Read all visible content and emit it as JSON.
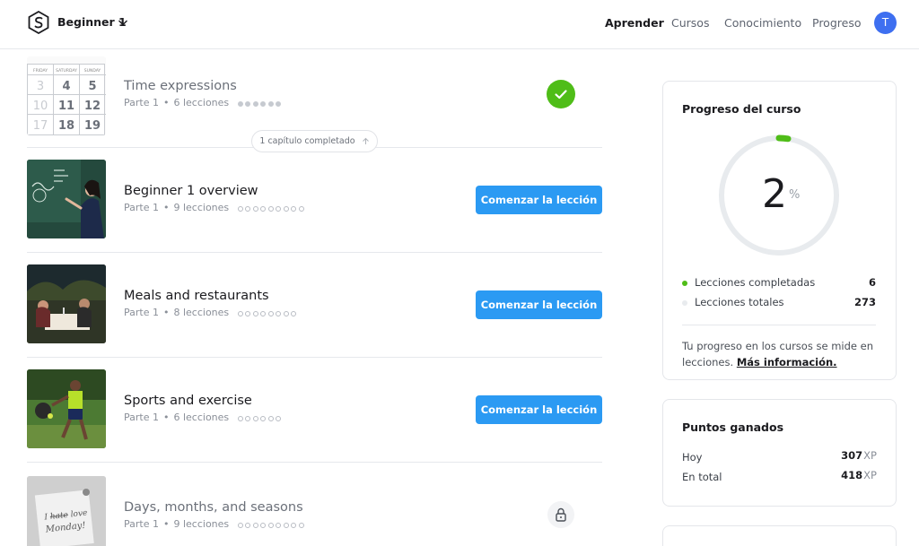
{
  "header": {
    "course_name": "Beginner 1",
    "nav": [
      "Aprender",
      "Cursos",
      "Conocimiento",
      "Progreso"
    ],
    "active_nav": "Aprender",
    "avatar_initial": "T"
  },
  "lessons": [
    {
      "title": "Time expressions",
      "part": "Parte 1",
      "count": "6 lecciones",
      "dots_total": 6,
      "dots_filled": 6,
      "state": "completed"
    },
    {
      "title": "Beginner 1 overview",
      "part": "Parte 1",
      "count": "9 lecciones",
      "dots_total": 9,
      "dots_filled": 0,
      "state": "start",
      "button": "Comenzar la lección"
    },
    {
      "title": "Meals and restaurants",
      "part": "Parte 1",
      "count": "8 lecciones",
      "dots_total": 8,
      "dots_filled": 0,
      "state": "start",
      "button": "Comenzar la lección"
    },
    {
      "title": "Sports and exercise",
      "part": "Parte 1",
      "count": "6 lecciones",
      "dots_total": 6,
      "dots_filled": 0,
      "state": "start",
      "button": "Comenzar la lección"
    },
    {
      "title": "Days, months, and seasons",
      "part": "Parte 1",
      "count": "9 lecciones",
      "dots_total": 9,
      "dots_filled": 0,
      "state": "locked"
    }
  ],
  "chapter_pill": "1 capítulo completado",
  "calendar": {
    "days": [
      "FRIDAY",
      "SATURDAY",
      "SUNDAY"
    ],
    "numbers": [
      "3",
      "4",
      "5",
      "10",
      "11",
      "12",
      "17",
      "18",
      "19"
    ]
  },
  "sticky_note": "I hate love Monday!",
  "progress_card": {
    "title": "Progreso del curso",
    "percent": "2",
    "percent_sign": "%",
    "completed_label": "Lecciones completadas",
    "completed_value": "6",
    "total_label": "Lecciones totales",
    "total_value": "273",
    "note": "Tu progreso en los cursos se mide en lecciones.",
    "link": "Más información."
  },
  "points_card": {
    "title": "Puntos ganados",
    "today_label": "Hoy",
    "today_value": "307",
    "total_label": "En total",
    "total_value": "418",
    "unit": "XP"
  },
  "colors": {
    "accent": "#2b9af3",
    "success": "#4fbd18",
    "avatar": "#3e6ff0"
  }
}
